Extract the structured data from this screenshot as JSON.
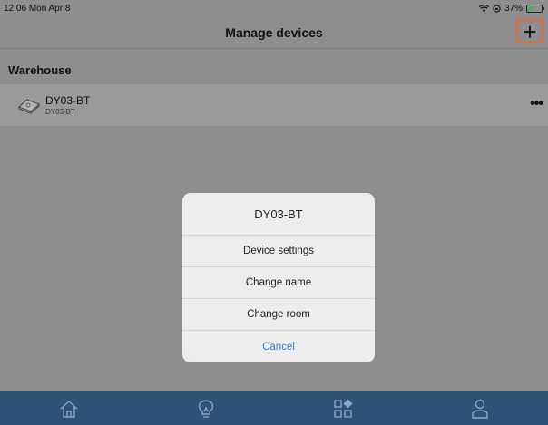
{
  "status": {
    "time": "12:06",
    "date": "Mon Apr 8",
    "battery": "37%",
    "battery_level": 0.37
  },
  "nav": {
    "title": "Manage devices",
    "add_icon": "plus-icon",
    "add_label": "+"
  },
  "section": {
    "title": "Warehouse"
  },
  "device": {
    "name": "DY03-BT",
    "subtitle": "DY03-BT",
    "more_label": "•••"
  },
  "dialog": {
    "title": "DY03-BT",
    "items": [
      {
        "label": "Device settings"
      },
      {
        "label": "Change name"
      },
      {
        "label": "Change room"
      }
    ],
    "cancel": "Cancel"
  },
  "tabs": [
    {
      "icon": "home-icon"
    },
    {
      "icon": "lightbulb-icon"
    },
    {
      "icon": "scenes-grid-icon"
    },
    {
      "icon": "profile-icon"
    }
  ],
  "colors": {
    "accent": "#e8693d",
    "tabbar": "#2c5277",
    "cancel": "#2f7fd8"
  }
}
